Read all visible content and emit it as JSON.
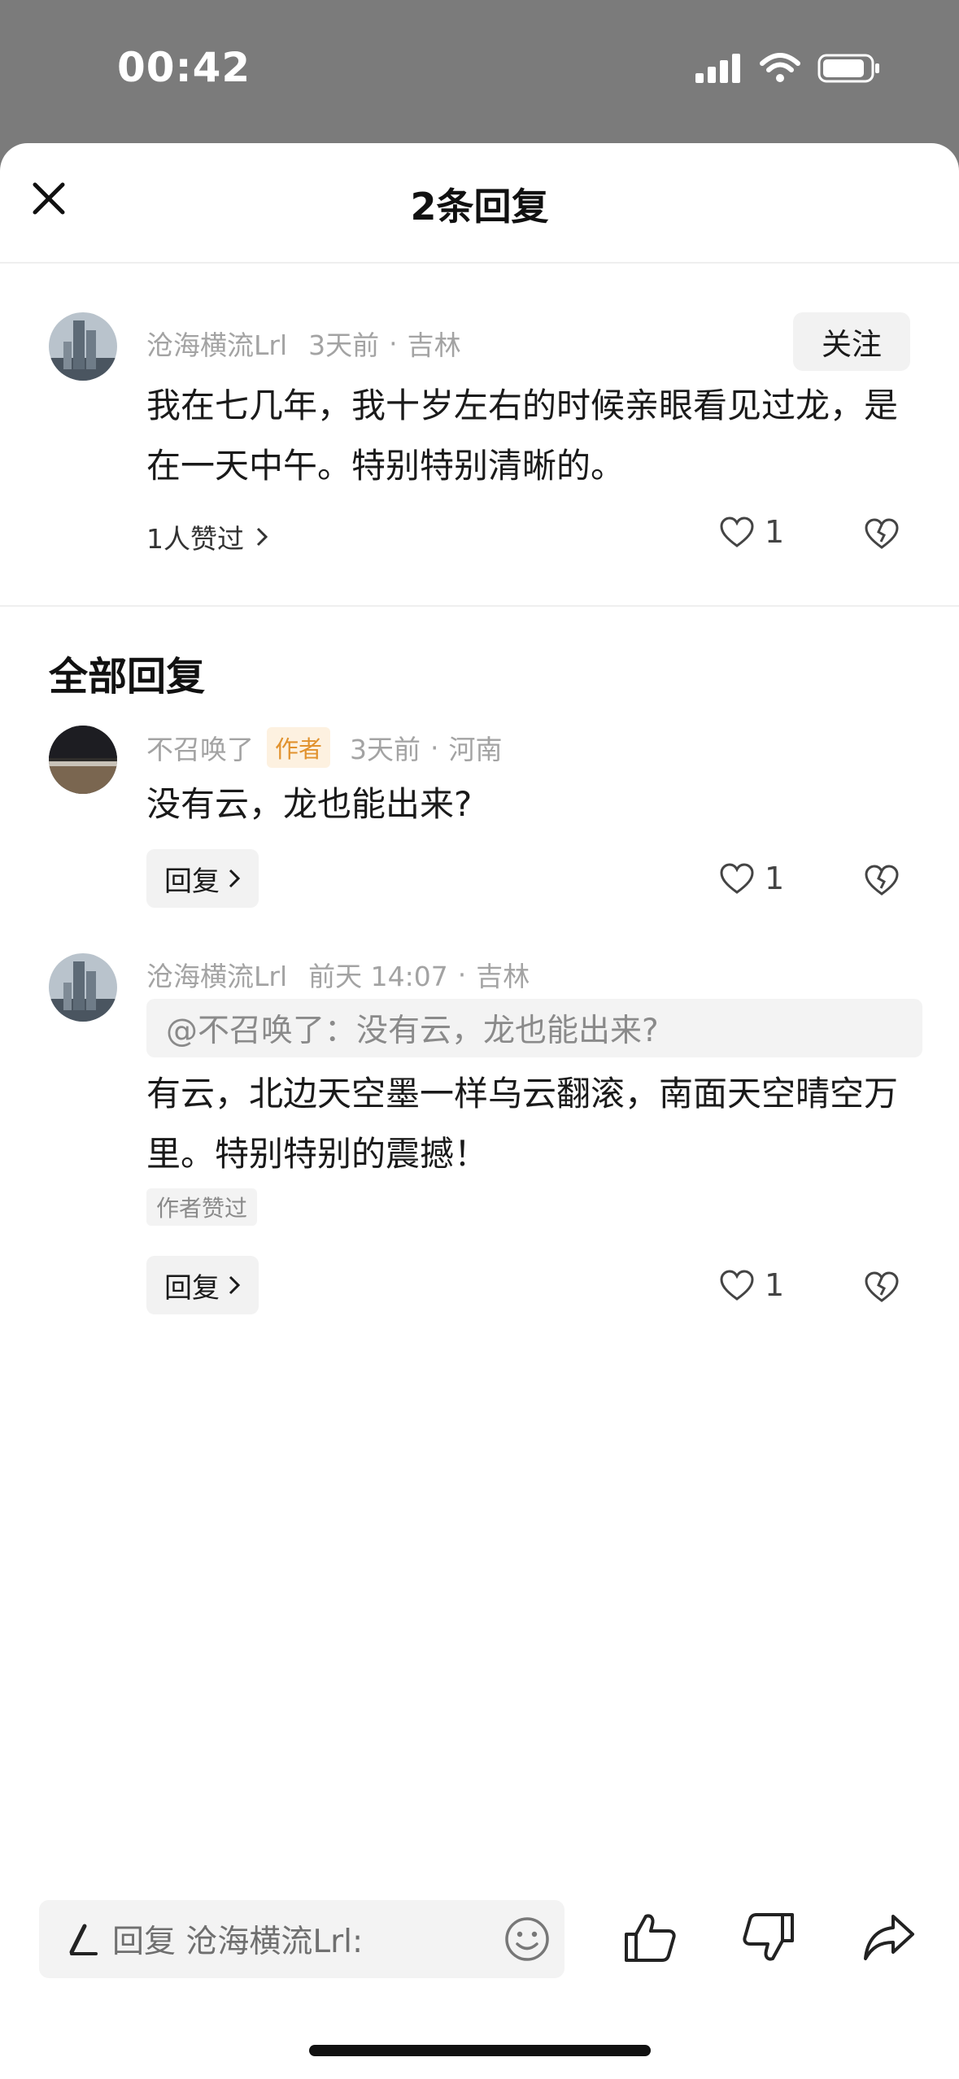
{
  "status_bar": {
    "time": "00:42"
  },
  "header": {
    "title": "2条回复"
  },
  "main_comment": {
    "author": "沧海横流Lrl",
    "time": "3天前",
    "location": "吉林",
    "follow_label": "关注",
    "text": "我在七几年，我十岁左右的时候亲眼看见过龙，是在一天中午。特别特别清晰的。",
    "likes_summary": "1人赞过",
    "like_count": "1"
  },
  "replies_section": {
    "title": "全部回复",
    "items": [
      {
        "author": "不召唤了",
        "author_tag": "作者",
        "time": "3天前",
        "location": "河南",
        "text": "没有云，龙也能出来?",
        "reply_label": "回复",
        "like_count": "1"
      },
      {
        "author": "沧海横流Lrl",
        "time": "前天 14:07",
        "location": "吉林",
        "quote": "@不召唤了：没有云，龙也能出来?",
        "text": "有云，北边天空墨一样乌云翻滚，南面天空晴空万里。特别特别的震撼！",
        "author_liked": "作者赞过",
        "reply_label": "回复",
        "like_count": "1"
      }
    ]
  },
  "bottom_bar": {
    "reply_placeholder": "回复 沧海横流Lrl:"
  },
  "separator_dot": "·",
  "icons": [
    "close-icon",
    "heart-icon",
    "broken-heart-icon",
    "chevron-right-icon",
    "pen-icon",
    "emoji-icon",
    "thumbs-up-icon",
    "thumbs-down-icon",
    "share-icon",
    "signal-icon",
    "wifi-icon",
    "battery-icon"
  ]
}
